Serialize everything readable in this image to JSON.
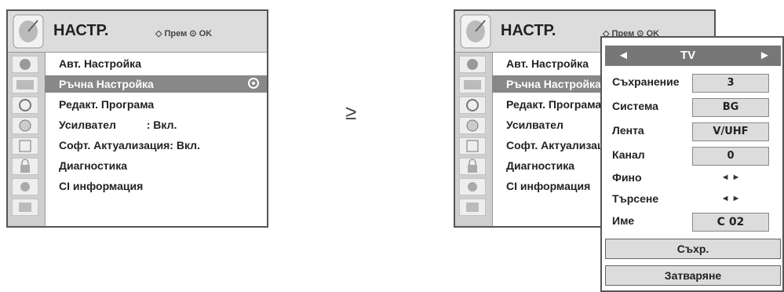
{
  "left_menu": {
    "title": "НАСТР.",
    "hint": "◇ Прем ⊙ OK",
    "items": [
      {
        "label": "Авт. Настройка"
      },
      {
        "label": "Ръчна Настройка"
      },
      {
        "label": "Редакт. Програма"
      },
      {
        "label": "Усилвател          : Вкл."
      },
      {
        "label": "Софт. Актуализация: Вкл."
      },
      {
        "label": "Диагностика"
      },
      {
        "label": "CI информация"
      }
    ],
    "selected_index": 1
  },
  "right_menu": {
    "title": "НАСТР.",
    "hint": "◇ Прем ⊙ OK",
    "items": [
      {
        "label": "Авт. Настройка"
      },
      {
        "label": "Ръчна Настройка"
      },
      {
        "label": "Редакт. Програма"
      },
      {
        "label": "Усилвател"
      },
      {
        "label": "Софт. Актуализация"
      },
      {
        "label": "Диагностика"
      },
      {
        "label": "CI информация"
      }
    ]
  },
  "separator": "≥",
  "popup": {
    "source_left": "◄",
    "source": "TV",
    "source_right": "►",
    "rows": [
      {
        "label": "Съхранение",
        "value": "3"
      },
      {
        "label": "Система",
        "value": "BG"
      },
      {
        "label": "Лента",
        "value": "V/UHF"
      },
      {
        "label": "Канал",
        "value": "0"
      },
      {
        "label": "Фино",
        "value": "◄ ►"
      },
      {
        "label": "Търсене",
        "value": "◄ ►"
      },
      {
        "label": "Име",
        "value": "C 02"
      }
    ],
    "save_button": "Съхр.",
    "close_button": "Затваряне"
  },
  "side_icons": [
    "satellite-dish-icon",
    "picture-icon",
    "audio-icon",
    "clock-icon",
    "option-icon",
    "lock-icon",
    "input-icon",
    "usb-icon"
  ]
}
